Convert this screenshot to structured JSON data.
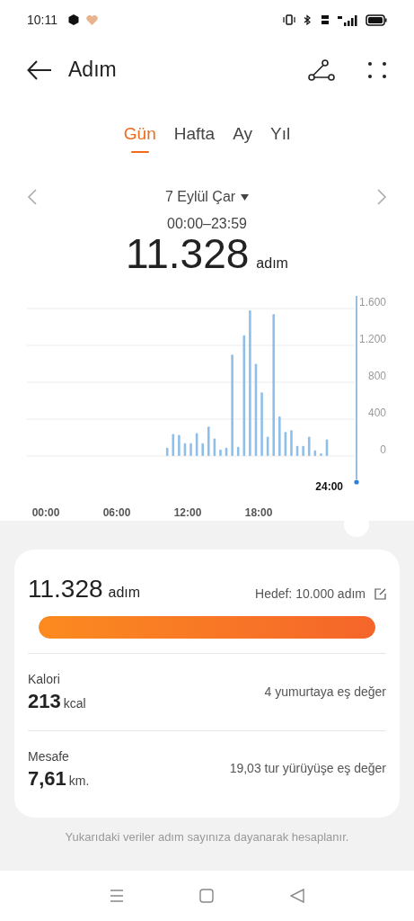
{
  "status_bar": {
    "time": "10:11"
  },
  "header": {
    "title": "Adım"
  },
  "tabs": [
    {
      "label": "Gün",
      "selected": true
    },
    {
      "label": "Hafta",
      "selected": false
    },
    {
      "label": "Ay",
      "selected": false
    },
    {
      "label": "Yıl",
      "selected": false
    }
  ],
  "date_nav": {
    "date": "7 Eylül Çar",
    "range": "00:00–23:59",
    "total": "11.328",
    "unit": "adım"
  },
  "chart": {
    "cursor_label": "24:00",
    "chart_data": {
      "type": "bar",
      "x": [
        10,
        10.5,
        11,
        11.5,
        12,
        12.5,
        13,
        13.5,
        14,
        14.5,
        15,
        15.5,
        16,
        16.5,
        17,
        17.5,
        18,
        18.5,
        19,
        19.5,
        20,
        20.5,
        21,
        21.5,
        22,
        22.5,
        23,
        23.5
      ],
      "grid": true,
      "series": [
        {
          "color": "#8fbfe8",
          "values": [
            90,
            240,
            230,
            140,
            140,
            250,
            140,
            320,
            190,
            70,
            90,
            1100,
            100,
            1310,
            1580,
            1000,
            690,
            210,
            1540,
            430,
            260,
            280,
            110,
            110,
            210,
            60,
            30,
            180
          ]
        }
      ],
      "xlim": [
        0,
        24
      ],
      "ylim": [
        0,
        1600
      ],
      "xticks": [
        {
          "value": 0,
          "label": "00:00"
        },
        {
          "value": 6,
          "label": "06:00"
        },
        {
          "value": 12,
          "label": "12:00"
        },
        {
          "value": 18,
          "label": "18:00"
        }
      ],
      "yticks": [
        {
          "value": 0,
          "label": "0"
        },
        {
          "value": 400,
          "label": "400"
        },
        {
          "value": 800,
          "label": "800"
        },
        {
          "value": 1200,
          "label": "1.200"
        },
        {
          "value": 1600,
          "label": "1.600"
        }
      ]
    }
  },
  "summary": {
    "steps": "11.328",
    "steps_unit": "adım",
    "goal": "Hedef: 10.000 adım",
    "level": 1,
    "stats": [
      {
        "label": "Kalori",
        "value": "213",
        "unit": "kcal",
        "note": "4 yumurtaya eş değer"
      },
      {
        "label": "Mesafe",
        "value": "7,61",
        "unit": "km.",
        "note": "19,03 tur yürüyüşe eş değer"
      }
    ]
  },
  "footnote": "Yukarıdaki veriler adım sayınıza dayanarak hesaplanır."
}
